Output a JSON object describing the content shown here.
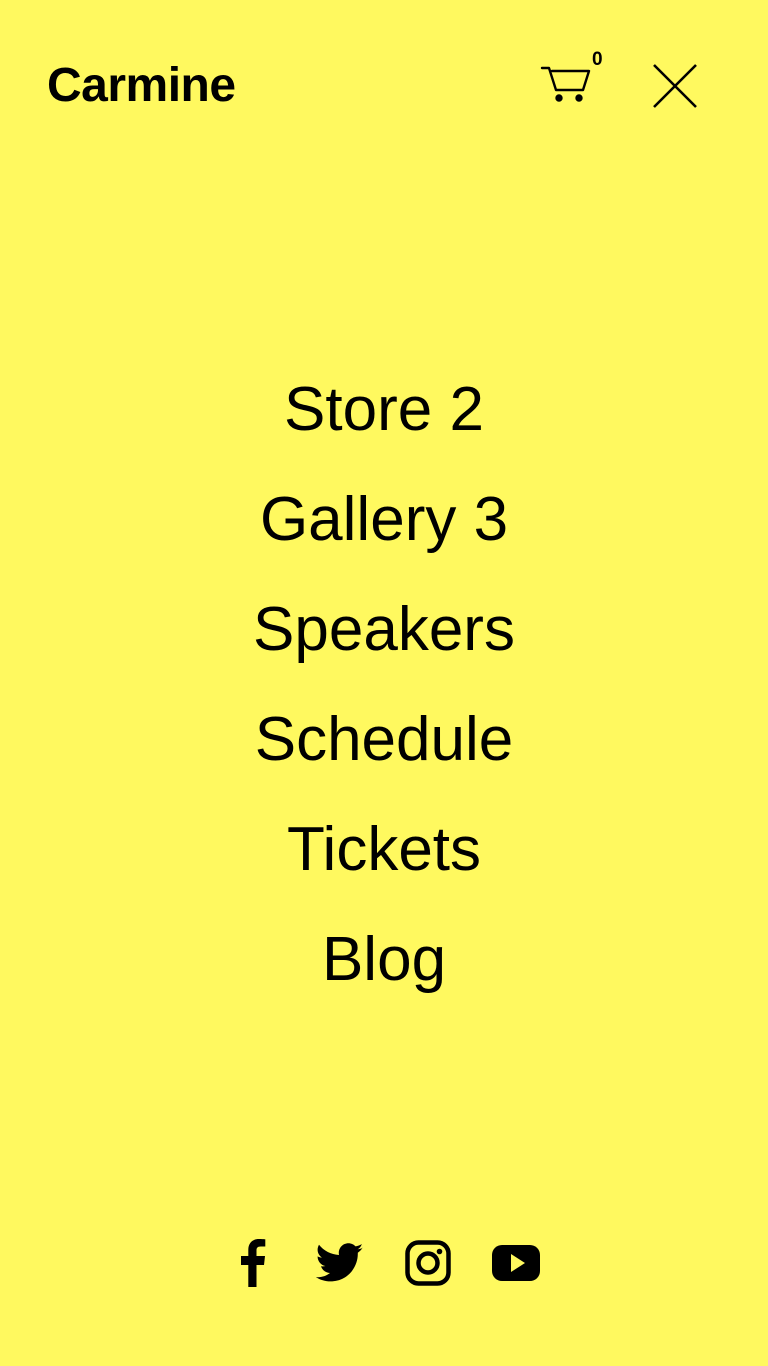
{
  "theme": {
    "background": "#FFF95F",
    "foreground": "#000000"
  },
  "header": {
    "brand": "Carmine",
    "cart_icon": "cart-icon",
    "cart_count": "0",
    "close_icon": "close-icon"
  },
  "nav": {
    "items": [
      {
        "label": "Store 2"
      },
      {
        "label": "Gallery 3"
      },
      {
        "label": "Speakers"
      },
      {
        "label": "Schedule"
      },
      {
        "label": "Tickets"
      },
      {
        "label": "Blog"
      }
    ]
  },
  "social": {
    "icons": [
      "facebook-icon",
      "twitter-icon",
      "instagram-icon",
      "youtube-icon"
    ]
  }
}
